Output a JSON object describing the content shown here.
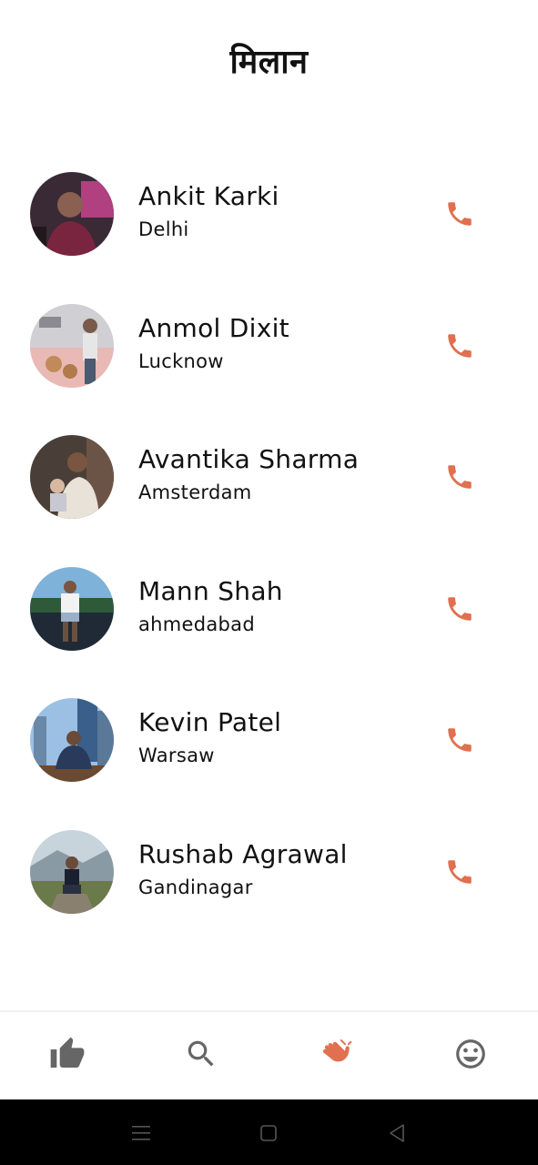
{
  "header": {
    "title": "मिलान"
  },
  "matches": [
    {
      "name": "Ankit Karki",
      "city": "Delhi",
      "avatar_colors": [
        "#3a2a35",
        "#b04080",
        "#7a2540"
      ]
    },
    {
      "name": "Anmol Dixit",
      "city": "Lucknow",
      "avatar_colors": [
        "#e8b9b5",
        "#cfcfd4",
        "#8a7060"
      ]
    },
    {
      "name": "Avantika Sharma",
      "city": "Amsterdam",
      "avatar_colors": [
        "#4a3f38",
        "#e9e2d8",
        "#6b5446"
      ]
    },
    {
      "name": "Mann Shah",
      "city": "ahmedabad",
      "avatar_colors": [
        "#7fb2d8",
        "#2f5a3a",
        "#1f2a36"
      ]
    },
    {
      "name": "Kevin Patel",
      "city": "Warsaw",
      "avatar_colors": [
        "#9cc0e4",
        "#3a5f8a",
        "#6a4a30"
      ]
    },
    {
      "name": "Rushab Agrawal",
      "city": "Gandinagar",
      "avatar_colors": [
        "#c8d4dc",
        "#6a7a4a",
        "#8a8070"
      ]
    }
  ],
  "colors": {
    "accent": "#e0704f",
    "nav_icon": "#666666",
    "nav_active": "#e0704f"
  },
  "bottom_nav": [
    {
      "icon": "thumbs-up-icon",
      "active": false
    },
    {
      "icon": "search-icon",
      "active": false
    },
    {
      "icon": "clap-hands-icon",
      "active": true
    },
    {
      "icon": "smiley-icon",
      "active": false
    }
  ],
  "system_nav": [
    {
      "icon": "menu-icon"
    },
    {
      "icon": "home-square-icon"
    },
    {
      "icon": "back-triangle-icon"
    }
  ]
}
